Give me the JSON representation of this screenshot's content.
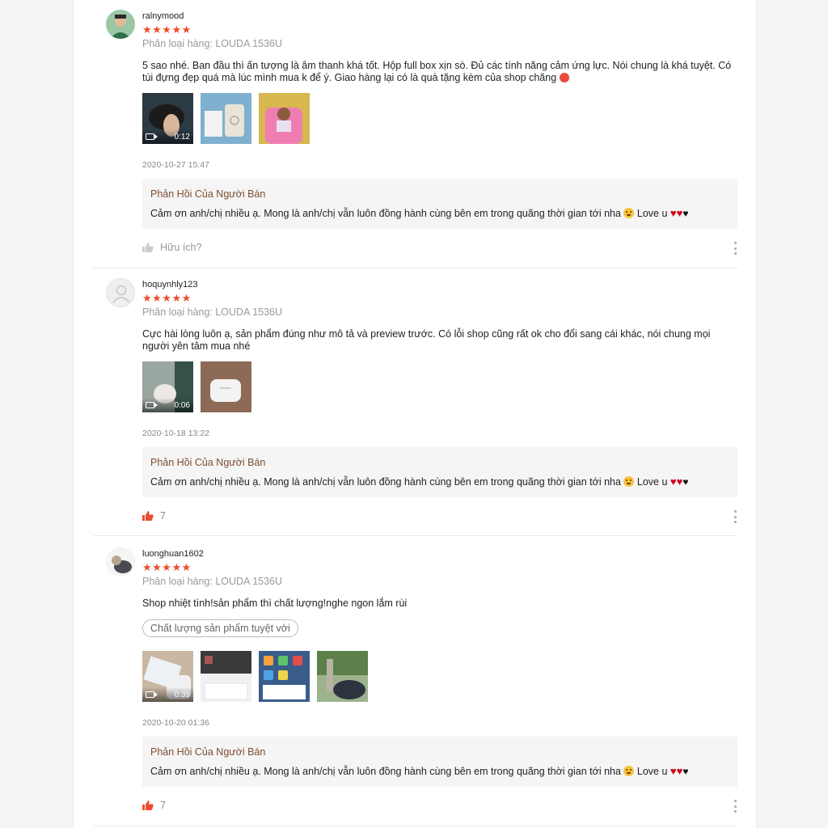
{
  "reviews": [
    {
      "username": "ralnymood",
      "stars": "★★★★★",
      "variant": "Phân loại hàng: LOUDA 1536U",
      "comment": "5 sao nhé. Ban đầu thì ấn tượng là âm thanh khá tốt. Hộp full box xịn sò. Đủ các tính năng cảm ứng lực. Nói chung là khá tuyệt. Có túi đựng đẹp quá mà lúc mình mua k để ý. Giao hàng lại có là quà tặng kèm của shop chăng",
      "video_duration": "0:12",
      "date": "2020-10-27 15:47",
      "reply_title": "Phản Hồi Của Người Bán",
      "reply_text": "Cảm ơn anh/chị nhiều ạ. Mong là anh/chị vẫn luôn đồng hành cùng bên em  trong quãng thời gian tới nha",
      "reply_love": "Love u",
      "like_label": "Hữu ích?"
    },
    {
      "username": "hoquynhly123",
      "stars": "★★★★★",
      "variant": "Phân loại hàng: LOUDA 1536U",
      "comment": "Cực hài lòng luôn ạ, sản phẩm đúng như mô tả và preview trước. Có lỗi shop cũng rất ok cho đổi sang cái khác, nói chung mọi người yên tâm mua nhé",
      "video_duration": "0:06",
      "date": "2020-10-18 13:22",
      "reply_title": "Phản Hồi Của Người Bán",
      "reply_text": "Cảm ơn anh/chị nhiều ạ. Mong là anh/chị vẫn luôn đồng hành cùng bên em  trong quãng thời gian tới nha",
      "reply_love": "Love u",
      "like_count": "7"
    },
    {
      "username": "luonghuan1602",
      "stars": "★★★★★",
      "variant": "Phân loại hàng: LOUDA 1536U",
      "comment": "Shop nhiệt tình!sản phẩm thì chất lượng!nghe ngon lắm rùi",
      "tag": "Chất lượng sản phẩm tuyệt vời",
      "video_duration": "0:39",
      "date": "2020-10-20 01:36",
      "reply_title": "Phản Hồi Của Người Bán",
      "reply_text": "Cảm ơn anh/chị nhiều ạ. Mong là anh/chị vẫn luôn đồng hành cùng bên em  trong quãng thời gian tới nha",
      "reply_love": "Love u",
      "like_count": "7"
    }
  ],
  "colors": {
    "accent": "#ee4d2d",
    "reply_title": "#7d4d2e",
    "reply_bg": "#f5f5f5"
  }
}
